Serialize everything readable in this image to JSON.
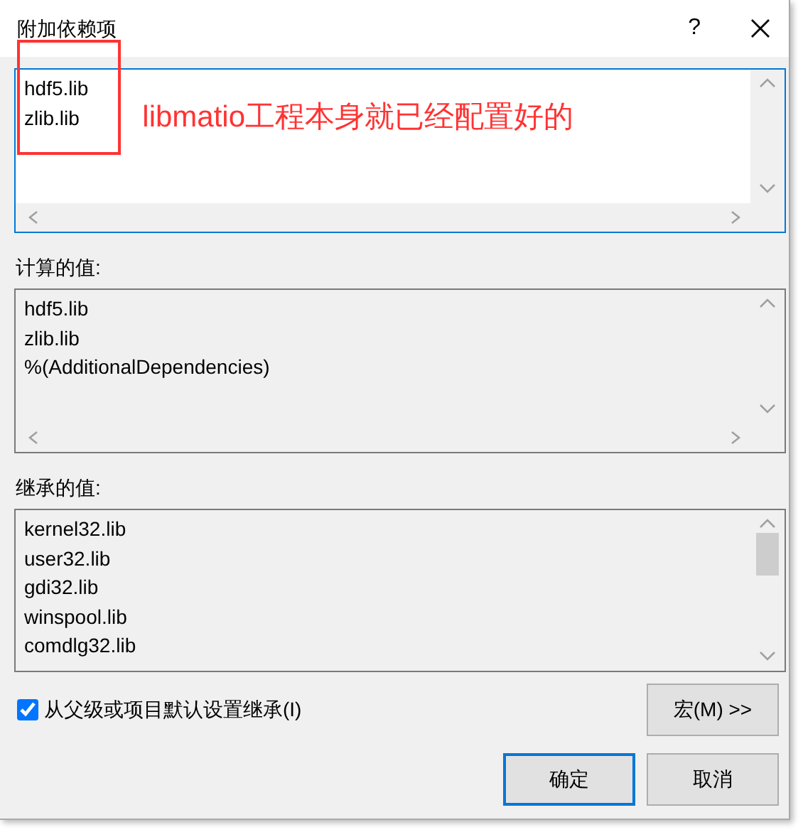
{
  "window": {
    "title": "附加依赖项",
    "help_button": "?"
  },
  "edit_box": {
    "lines": [
      "hdf5.lib",
      "zlib.lib"
    ]
  },
  "annotation": {
    "text": "libmatio工程本身就已经配置好的",
    "color": "#ff3333"
  },
  "evaluated": {
    "label": "计算的值:",
    "lines": [
      "hdf5.lib",
      "zlib.lib",
      "%(AdditionalDependencies)"
    ]
  },
  "inherited": {
    "label": "继承的值:",
    "lines": [
      "kernel32.lib",
      "user32.lib",
      "gdi32.lib",
      "winspool.lib",
      "comdlg32.lib"
    ]
  },
  "inherit_checkbox": {
    "label": "从父级或项目默认设置继承(I)",
    "checked": true
  },
  "buttons": [
    {
      "kind": "macro",
      "label": "宏(M) >>",
      "default": false
    },
    {
      "kind": "ok",
      "label": "确定",
      "default": true
    },
    {
      "kind": "cancel",
      "label": "取消",
      "default": false
    }
  ]
}
